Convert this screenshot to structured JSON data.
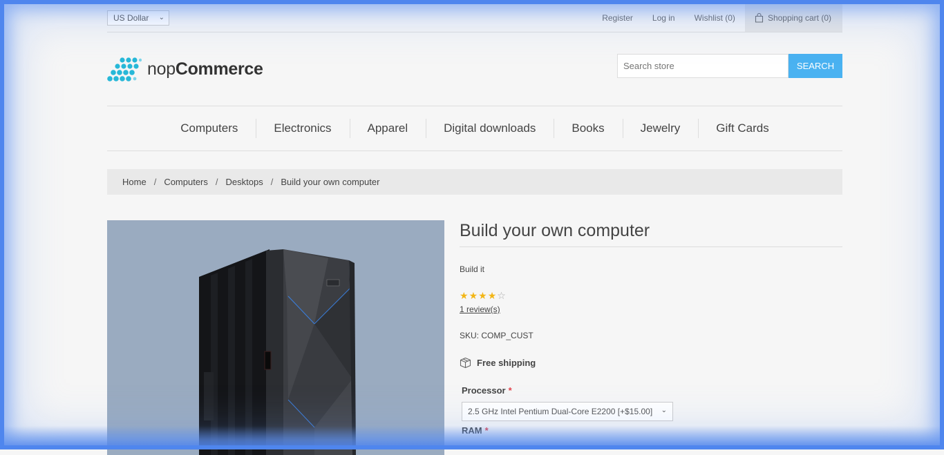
{
  "header": {
    "currency": "US Dollar",
    "links": {
      "register": "Register",
      "login": "Log in",
      "wishlist": "Wishlist (0)",
      "cart": "Shopping cart (0)"
    }
  },
  "logo": {
    "prefix": "nop",
    "brand": "Commerce"
  },
  "search": {
    "placeholder": "Search store",
    "button": "SEARCH"
  },
  "menu": [
    "Computers",
    "Electronics",
    "Apparel",
    "Digital downloads",
    "Books",
    "Jewelry",
    "Gift Cards"
  ],
  "breadcrumb": [
    "Home",
    "Computers",
    "Desktops",
    "Build your own computer"
  ],
  "product": {
    "title": "Build your own computer",
    "short_description": "Build it",
    "rating": 4,
    "rating_max": 5,
    "reviews": "1 review(s)",
    "sku_label": "SKU:",
    "sku": "COMP_CUST",
    "shipping": "Free shipping",
    "attributes": [
      {
        "label": "Processor",
        "required": "*",
        "value": "2.5 GHz Intel Pentium Dual-Core E2200 [+$15.00]"
      },
      {
        "label": "RAM",
        "required": "*"
      }
    ]
  },
  "colors": {
    "accent": "#4ab2f1",
    "star": "#f2b617",
    "required": "#e4434b"
  }
}
